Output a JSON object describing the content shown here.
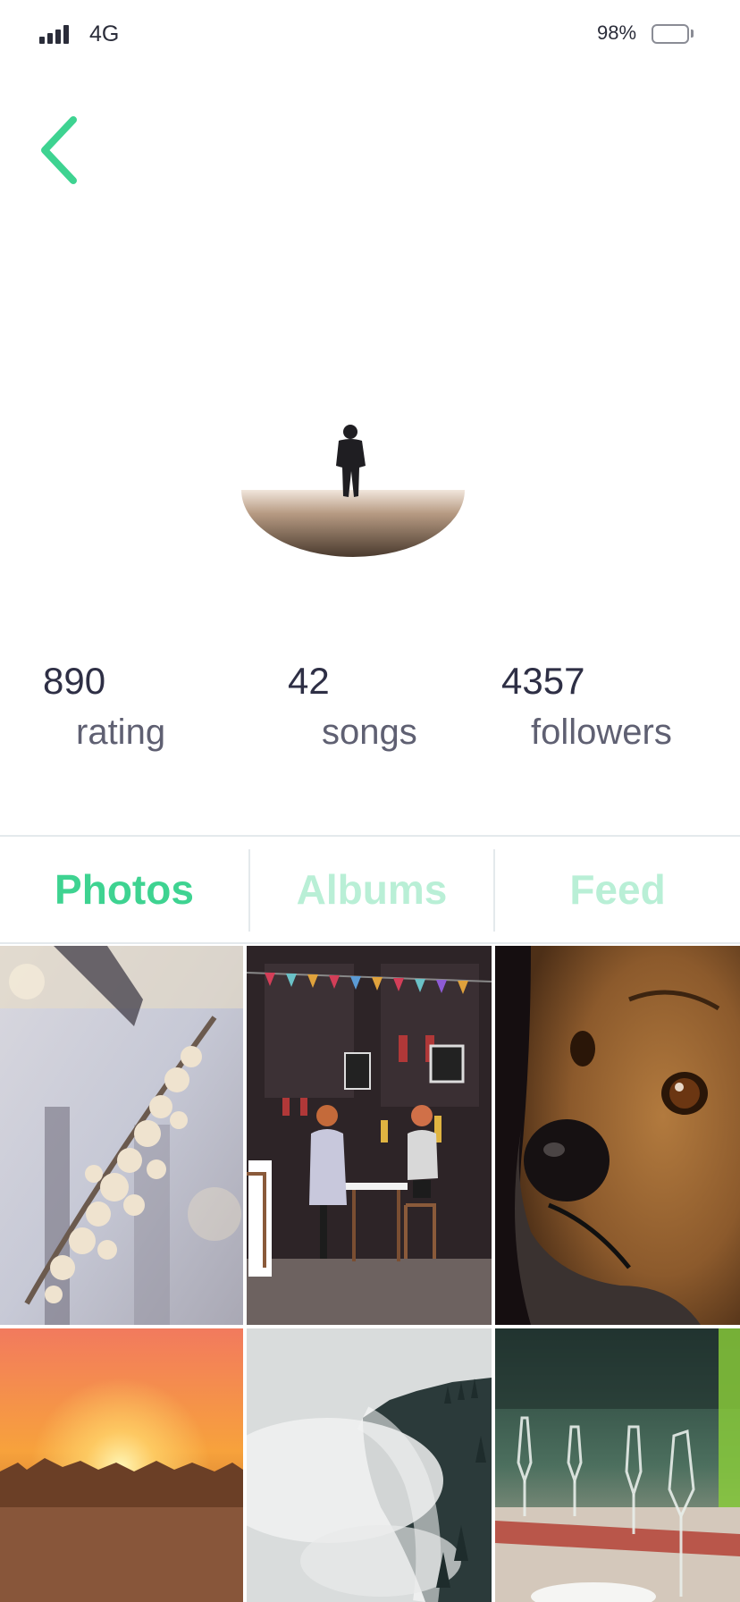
{
  "status_bar": {
    "network": "4G",
    "battery": "98%"
  },
  "icons": {
    "back": "chevron-left-icon"
  },
  "colors": {
    "accent": "#3ed391",
    "accent_faded": "#b9efd6",
    "text_dark": "#2e2f45",
    "text_muted": "#5f6072",
    "divider": "#e4e9ec"
  },
  "profile": {
    "avatar": "avatar-person-walking"
  },
  "stats": [
    {
      "value": "890",
      "label": "rating"
    },
    {
      "value": "42",
      "label": "songs"
    },
    {
      "value": "4357",
      "label": "followers"
    }
  ],
  "tabs": [
    {
      "label": "Photos",
      "active": true
    },
    {
      "label": "Albums",
      "active": false
    },
    {
      "label": "Feed",
      "active": false
    }
  ],
  "photos": [
    {
      "subject": "blossom-branch"
    },
    {
      "subject": "cafe-terrace"
    },
    {
      "subject": "dog-closeup"
    },
    {
      "subject": "sunset-forest"
    },
    {
      "subject": "misty-forest"
    },
    {
      "subject": "wine-glasses"
    }
  ]
}
